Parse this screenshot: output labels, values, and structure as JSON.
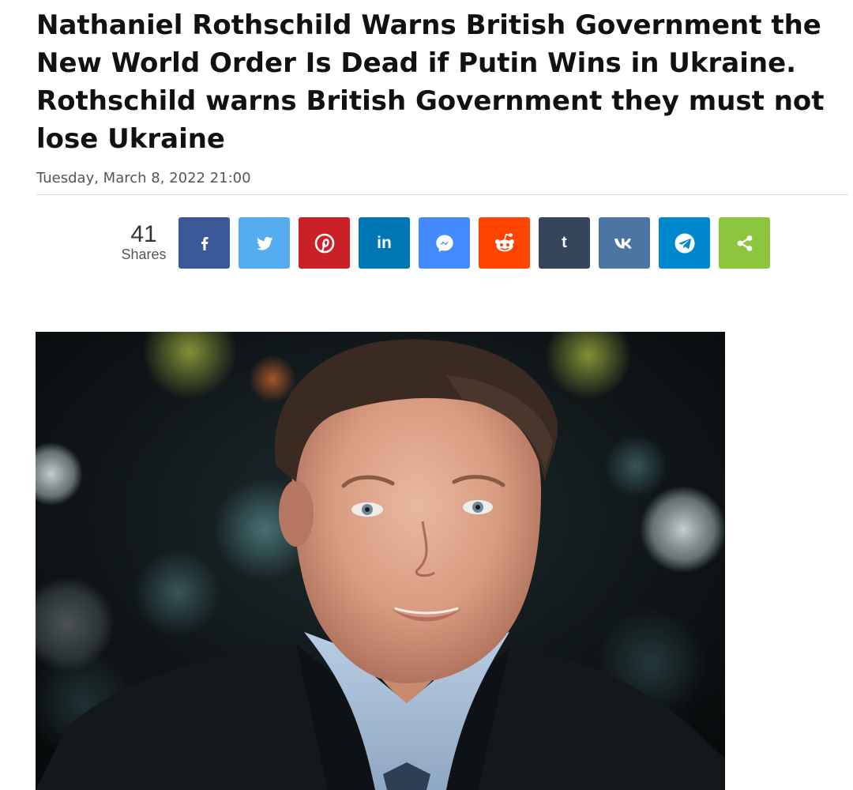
{
  "article": {
    "headline": "Nathaniel Rothschild Warns British Government the New World Order Is Dead if Putin Wins in Ukraine. Rothschild warns British Government they must not lose Ukraine",
    "date": "Tuesday, March 8, 2022 21:00"
  },
  "share_bar": {
    "count": "41",
    "count_label": "Shares",
    "buttons": [
      {
        "name": "facebook",
        "icon": "facebook-icon",
        "color": "#3b5998"
      },
      {
        "name": "twitter",
        "icon": "twitter-icon",
        "color": "#55acee"
      },
      {
        "name": "pinterest",
        "icon": "pinterest-icon",
        "color": "#cb2027"
      },
      {
        "name": "linkedin",
        "icon": "linkedin-icon",
        "color": "#0077b5"
      },
      {
        "name": "messenger",
        "icon": "messenger-icon",
        "color": "#448aff"
      },
      {
        "name": "reddit",
        "icon": "reddit-icon",
        "color": "#ff4500"
      },
      {
        "name": "tumblr",
        "icon": "tumblr-icon",
        "color": "#35465c"
      },
      {
        "name": "vk",
        "icon": "vk-icon",
        "color": "#4c75a3"
      },
      {
        "name": "telegram",
        "icon": "telegram-icon",
        "color": "#0088cc"
      },
      {
        "name": "share",
        "icon": "share-icon",
        "color": "#8cc63f"
      }
    ]
  }
}
